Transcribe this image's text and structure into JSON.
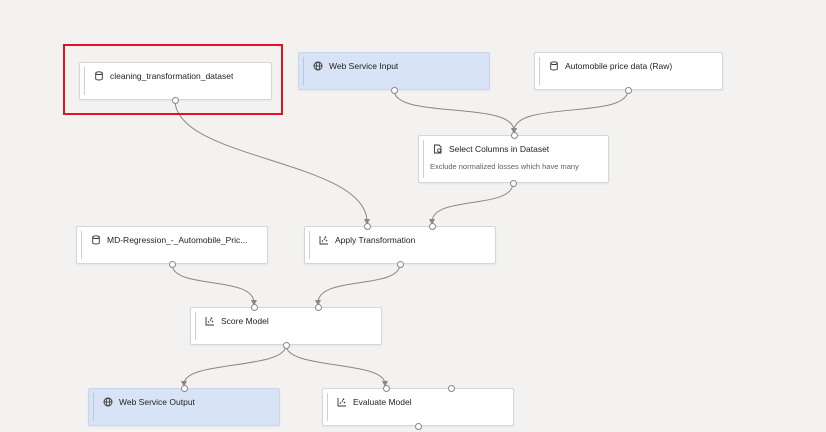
{
  "pipeline": {
    "nodes": {
      "cleaning": {
        "title": "cleaning_transformation_dataset",
        "icon": "dataset-icon"
      },
      "web_input": {
        "title": "Web Service Input",
        "icon": "globe-icon"
      },
      "automobile_raw": {
        "title": "Automobile price data (Raw)",
        "icon": "dataset-icon"
      },
      "select_columns": {
        "title": "Select Columns in Dataset",
        "description": "Exclude normalized losses which have many",
        "icon": "select-columns-icon"
      },
      "md_regression": {
        "title": "MD-Regression_-_Automobile_Pric...",
        "icon": "dataset-icon"
      },
      "apply_transformation": {
        "title": "Apply Transformation",
        "icon": "chart-icon"
      },
      "score_model": {
        "title": "Score Model",
        "icon": "chart-icon"
      },
      "web_output": {
        "title": "Web Service Output",
        "icon": "globe-icon"
      },
      "evaluate_model": {
        "title": "Evaluate Model",
        "icon": "chart-icon"
      }
    },
    "highlighted_node": "cleaning",
    "colors": {
      "canvas_background": "#f3f2f1",
      "node_background": "#ffffff",
      "web_service_node_background": "#d8e3f6",
      "connector": "#8a8886",
      "highlight_border": "#e81123"
    }
  }
}
